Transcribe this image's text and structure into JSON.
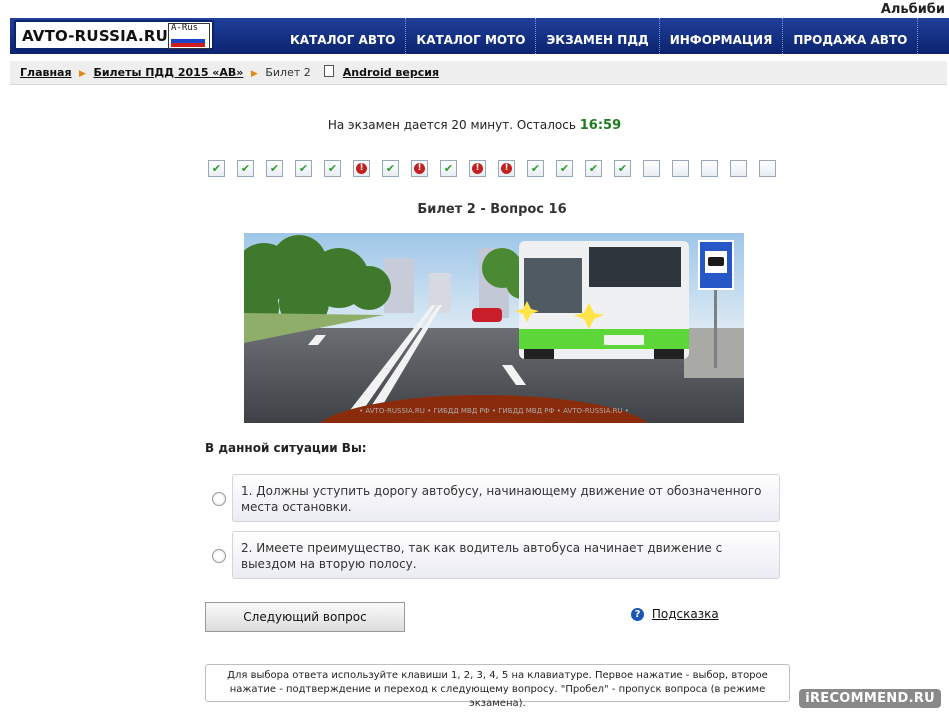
{
  "user": {
    "name": "Альбиби"
  },
  "site": {
    "logo_text": "AVTO-RUSSIA.RU",
    "logo_badge": "A-Rus",
    "flag_colors": [
      "#ffffff",
      "#1b44c8",
      "#d01c1c"
    ]
  },
  "nav": {
    "items": [
      {
        "label": "КАТАЛОГ АВТО"
      },
      {
        "label": "КАТАЛОГ МОТО"
      },
      {
        "label": "ЭКЗАМЕН ПДД"
      },
      {
        "label": "ИНФОРМАЦИЯ"
      },
      {
        "label": "ПРОДАЖА АВТО"
      }
    ]
  },
  "breadcrumb": {
    "home": "Главная",
    "section": "Билеты ПДД 2015 «АВ»",
    "current": "Билет 2",
    "android": "Android версия"
  },
  "timer": {
    "text": "На экзамен дается 20 минут. Осталось",
    "value": "16:59"
  },
  "progress": {
    "statuses": [
      "ok",
      "ok",
      "ok",
      "ok",
      "ok",
      "err",
      "ok",
      "err",
      "ok",
      "err",
      "err",
      "ok",
      "ok",
      "ok",
      "ok",
      "empty",
      "empty",
      "empty",
      "empty",
      "empty"
    ],
    "colors": {
      "ok": "#2e9b2e",
      "err": "#c42020"
    }
  },
  "question": {
    "title": "Билет 2 - Вопрос 16",
    "image_caption": "• AVTO-RUSSIA.RU • ГИБДД МВД РФ • ГИБДД МВД РФ • AVTO-RUSSIA.RU •",
    "text": "В данной ситуации Вы:",
    "answers": [
      {
        "text": "1. Должны уступить дорогу автобусу, начинающему движение от обозначенного места остановки."
      },
      {
        "text": "2. Имеете преимущество, так как водитель автобуса начинает движение с выездом на вторую полосу."
      }
    ]
  },
  "actions": {
    "next_label": "Следующий вопрос",
    "hint_icon": "?",
    "hint_label": "Подсказка"
  },
  "help": {
    "text": "Для выбора ответа используйте клавиши 1, 2, 3, 4, 5 на клавиатуре. Первое нажатие - выбор, второе нажатие - подтверждение и переход к следующему вопросу. \"Пробел\" - пропуск вопроса (в режиме экзамена)."
  },
  "watermark": {
    "text": "iRECOMMEND.RU"
  }
}
